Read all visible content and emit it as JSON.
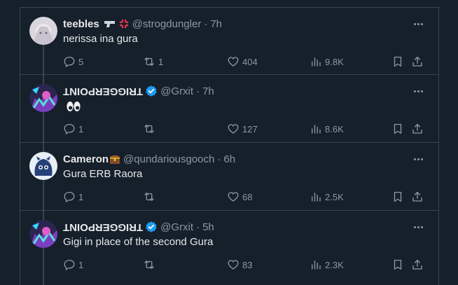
{
  "colors": {
    "background": "#15202b",
    "text": "#e7e9ea",
    "muted": "#8b98a5",
    "verified": "#1d9bf0",
    "border": "#38444d"
  },
  "tweets": [
    {
      "name": "teebles",
      "name_emojis": [
        "pistol-icon",
        "anger-icon"
      ],
      "handle": "@strogdungler",
      "time": "7h",
      "text": "nerissa ina gura",
      "replies": "5",
      "retweets": "1",
      "likes": "404",
      "views": "9.8K",
      "avatar": "white-haired-character-avatar"
    },
    {
      "name": "TRIGGERPOINT",
      "verified": true,
      "handle": "@Grxit",
      "time": "7h",
      "text": "👀",
      "replies": "1",
      "retweets": "",
      "likes": "127",
      "views": "8.6K",
      "avatar": "neon-character-avatar"
    },
    {
      "name": "Cameron",
      "name_emojis": [
        "treasure-chest-icon"
      ],
      "handle": "@qundariousgooch",
      "time": "6h",
      "text": "Gura ERB Raora",
      "replies": "1",
      "retweets": "",
      "likes": "68",
      "views": "2.5K",
      "avatar": "blue-creature-avatar"
    },
    {
      "name": "TRIGGERPOINT",
      "verified": true,
      "handle": "@Grxit",
      "time": "5h",
      "text": "Gigi in place of the second Gura",
      "replies": "1",
      "retweets": "",
      "likes": "83",
      "views": "2.3K",
      "avatar": "neon-character-avatar"
    }
  ]
}
